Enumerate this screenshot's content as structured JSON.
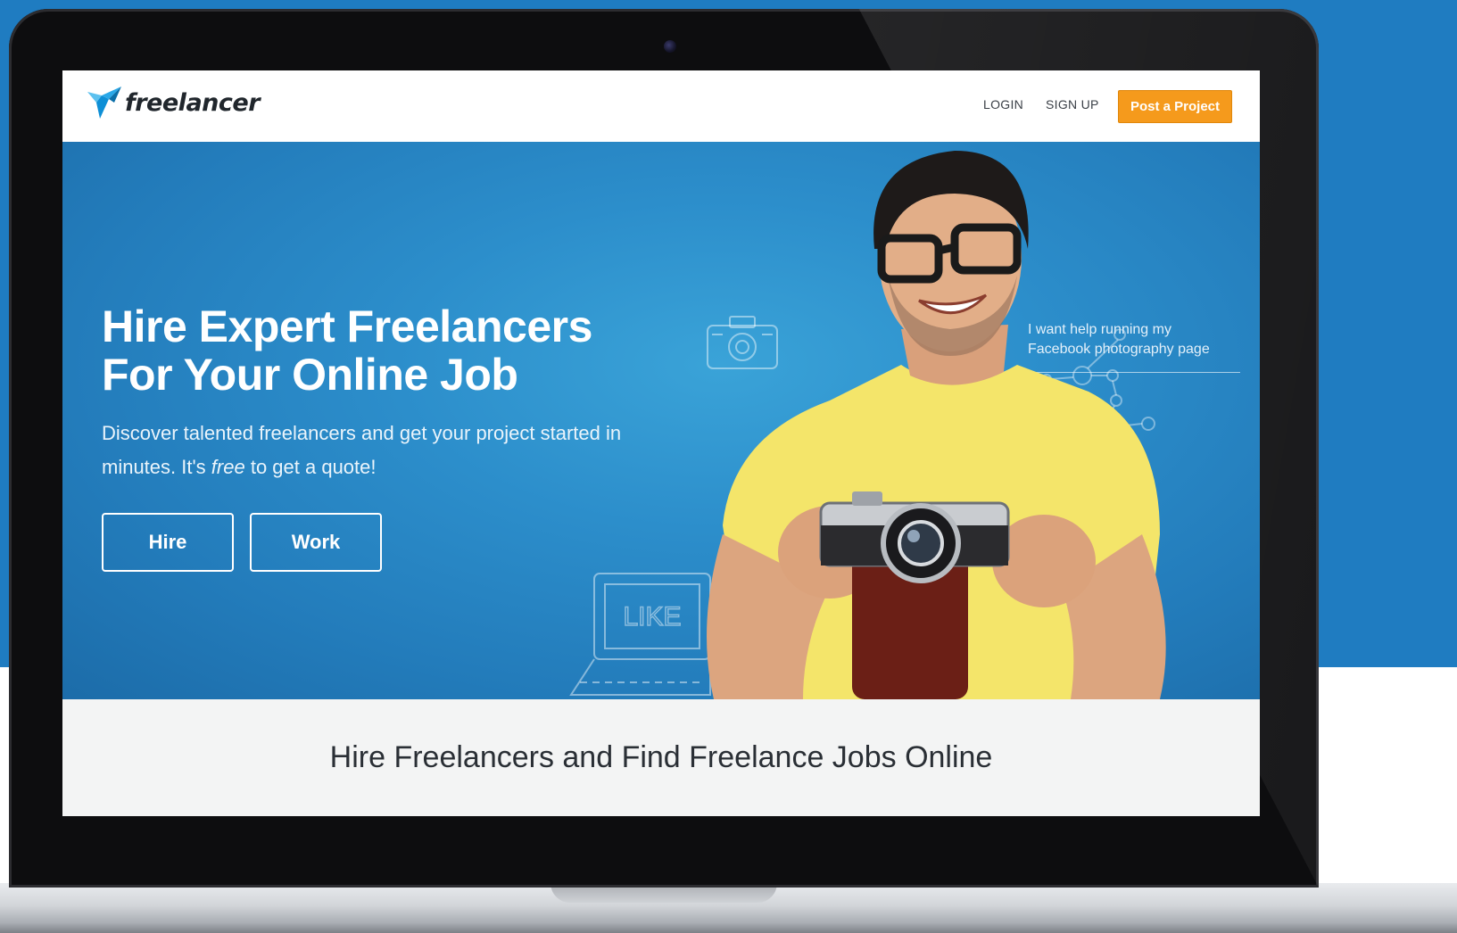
{
  "brand": {
    "logo_text": "freelancer",
    "color": "#0e8fd6"
  },
  "nav": {
    "login_label": "LOGIN",
    "signup_label": "SIGN UP",
    "post_button_label": "Post a Project",
    "post_button_color": "#f59a1c"
  },
  "hero": {
    "title_line1": "Hire Expert Freelancers",
    "title_line2": "For Your Online Job",
    "subtitle_part1": "Discover talented freelancers and get your project started in minutes. It's ",
    "subtitle_emphasis": "free",
    "subtitle_part2": " to get a quote!",
    "hire_label": "Hire",
    "work_label": "Work",
    "quote_line1": "I want help running my",
    "quote_line2": "Facebook photography page",
    "doodle_like_label": "LIKE",
    "background_color": "#2c8ecb"
  },
  "tagline": {
    "text": "Hire Freelancers and Find Freelance Jobs Online"
  },
  "icons": [
    "freelancer-logo-icon",
    "globe-icon",
    "camera-icon",
    "network-graph-icon",
    "laptop-like-icon",
    "webcam-icon"
  ],
  "page_background": "#1f7cc1"
}
